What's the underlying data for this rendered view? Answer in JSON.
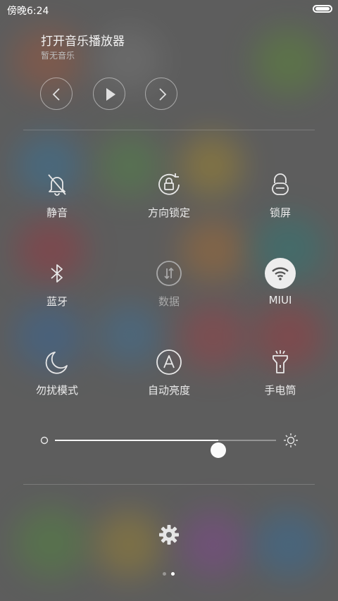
{
  "status_bar": {
    "time": "傍晚6:24",
    "battery_icon": "battery-full-icon"
  },
  "music": {
    "title": "打开音乐播放器",
    "subtitle": "暂无音乐",
    "controls": [
      "previous-icon",
      "play-icon",
      "next-icon"
    ]
  },
  "toggles": [
    {
      "label": "静音",
      "icon": "bell-muted-icon",
      "state": "off"
    },
    {
      "label": "方向锁定",
      "icon": "rotation-lock-icon",
      "state": "off"
    },
    {
      "label": "锁屏",
      "icon": "lock-icon",
      "state": "off"
    },
    {
      "label": "蓝牙",
      "icon": "bluetooth-icon",
      "state": "off"
    },
    {
      "label": "数据",
      "icon": "mobile-data-icon",
      "state": "disabled"
    },
    {
      "label": "MIUI",
      "icon": "wifi-icon",
      "state": "on"
    },
    {
      "label": "勿扰模式",
      "icon": "moon-icon",
      "state": "off"
    },
    {
      "label": "自动亮度",
      "icon": "auto-brightness-icon",
      "state": "off"
    },
    {
      "label": "手电筒",
      "icon": "flashlight-icon",
      "state": "off"
    }
  ],
  "brightness": {
    "level": 0.74,
    "min_icon": "brightness-low-icon",
    "max_icon": "sun-icon"
  },
  "settings": {
    "icon": "gear-icon"
  },
  "pager": {
    "pages": 2,
    "current": 2
  },
  "colors": {
    "active_toggle": "#ededed",
    "panel_overlay": "#5f5f5f"
  }
}
